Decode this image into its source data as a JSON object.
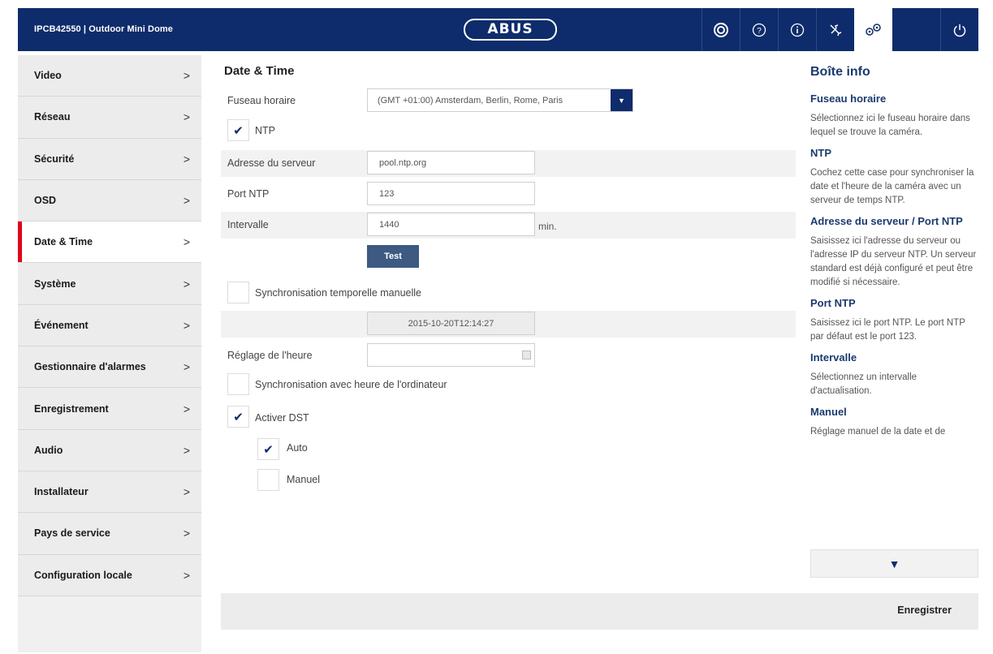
{
  "header": {
    "model": "IPCB42550 | Outdoor Mini Dome",
    "logo_text": "ABUS",
    "icons": [
      "camera-icon",
      "help-icon",
      "info-icon",
      "tools-icon",
      "settings-icon",
      "power-icon"
    ]
  },
  "sidebar": {
    "items": [
      {
        "label": "Video",
        "chev": ">"
      },
      {
        "label": "Réseau",
        "chev": ">"
      },
      {
        "label": "Sécurité",
        "chev": ">"
      },
      {
        "label": "OSD",
        "chev": ">"
      },
      {
        "label": "Date & Time",
        "chev": ">"
      },
      {
        "label": "Système",
        "chev": ">"
      },
      {
        "label": "Événement",
        "chev": ">"
      },
      {
        "label": "Gestionnaire d'alarmes",
        "chev": ">"
      },
      {
        "label": "Enregistrement",
        "chev": ">"
      },
      {
        "label": "Audio",
        "chev": ">"
      },
      {
        "label": "Installateur",
        "chev": ">"
      },
      {
        "label": "Pays de service",
        "chev": ">"
      },
      {
        "label": "Configuration locale",
        "chev": ">"
      }
    ],
    "active": "Date & Time"
  },
  "main": {
    "title": "Date & Time",
    "timezone_label": "Fuseau horaire",
    "timezone_value": "(GMT +01:00) Amsterdam, Berlin, Rome, Paris",
    "ntp_label": "NTP",
    "ntp_checked": true,
    "server_label": "Adresse du serveur",
    "server_value": "pool.ntp.org",
    "port_label": "Port NTP",
    "port_value": "123",
    "interval_label": "Intervalle",
    "interval_value": "1440",
    "interval_unit": "min.",
    "test_label": "Test",
    "manual_sync_label": "Synchronisation temporelle manuelle",
    "manual_sync_checked": false,
    "device_time": "2015-10-20T12:14:27",
    "set_time_label": "Réglage de l'heure",
    "set_time_value": "",
    "pc_sync_label": "Synchronisation avec heure de l'ordinateur",
    "pc_sync_checked": false,
    "dst_label": "Activer DST",
    "dst_checked": true,
    "auto_label": "Auto",
    "auto_checked": true,
    "manual_label": "Manuel",
    "manual_checked": false,
    "check_glyph": "✔"
  },
  "footer": {
    "save_label": "Enregistrer"
  },
  "info": {
    "title": "Boîte info",
    "sections": [
      {
        "heading": "Fuseau horaire",
        "text": "Sélectionnez ici le fuseau horaire dans lequel se trouve la caméra."
      },
      {
        "heading": "NTP",
        "text": "Cochez cette case pour synchroniser la date et l'heure de la caméra avec un serveur de temps NTP."
      },
      {
        "heading": "Adresse du serveur / Port NTP",
        "text": "Saisissez ici l'adresse du serveur ou l'adresse IP du serveur NTP. Un serveur standard est déjà configuré et peut être modifié si nécessaire."
      },
      {
        "heading": "Port NTP",
        "text": "Saisissez ici le port NTP. Le port NTP par défaut est le port 123."
      },
      {
        "heading": "Intervalle",
        "text": "Sélectionnez un intervalle d'actualisation."
      },
      {
        "heading": "Manuel",
        "text": "Réglage manuel de la date et de"
      }
    ],
    "scroll_glyph": "▼"
  },
  "colors": {
    "header_bg": "#0e2c6b",
    "active_marker": "#e2001a",
    "button_bg": "#3c5a82"
  }
}
